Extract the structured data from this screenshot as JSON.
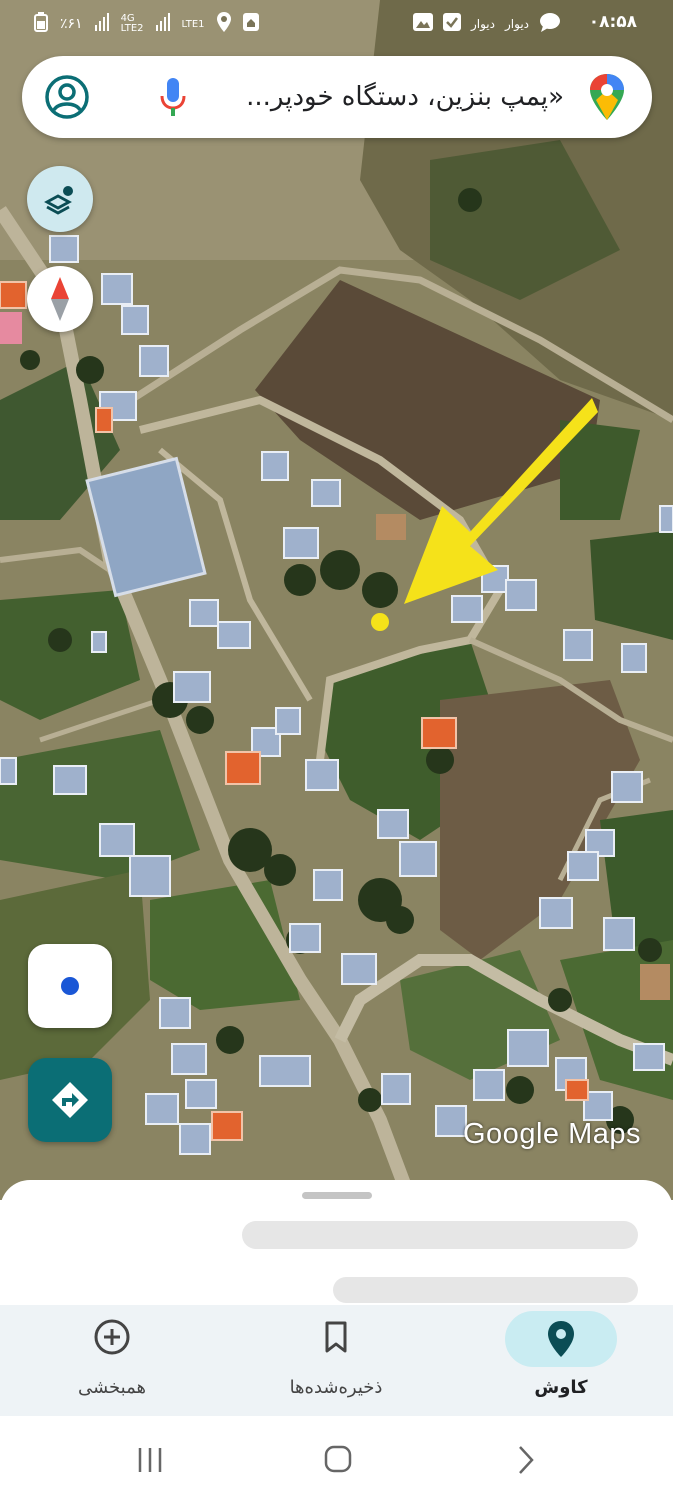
{
  "status_bar": {
    "time": "۰۸:۵۸",
    "battery": "٪۶۱",
    "network_1": "4G\nLTE2",
    "network_2": "LTE1",
    "app_label_1": "دیوار",
    "app_label_2": "دیوار"
  },
  "search": {
    "query": "«پمپ بنزین، دستگاه خودپر..."
  },
  "map": {
    "watermark": "Google Maps",
    "highlight_color": "#f5e21a"
  },
  "controls": {
    "layers_icon": "layers-icon",
    "compass_icon": "compass-icon",
    "location_icon": "my-location-icon",
    "directions_icon": "directions-icon"
  },
  "bottom_nav": {
    "items": [
      {
        "label": "همبخشی",
        "icon": "add-circle-icon",
        "active": false
      },
      {
        "label": "ذخیره‌شده‌ها",
        "icon": "bookmark-icon",
        "active": false
      },
      {
        "label": "کاوش",
        "icon": "explore-pin-icon",
        "active": true
      }
    ]
  },
  "colors": {
    "accent": "#0b6e75",
    "active_pill": "#c9ecf2",
    "nav_bg": "#eef3f6"
  }
}
